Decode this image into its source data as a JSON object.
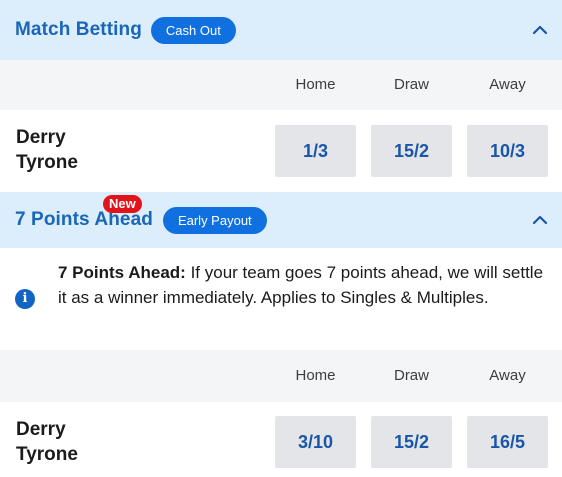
{
  "match_betting": {
    "title": "Match Betting",
    "badge": "Cash Out",
    "columns": [
      "Home",
      "Draw",
      "Away"
    ],
    "teams": [
      "Derry",
      "Tyrone"
    ],
    "odds": [
      "1/3",
      "15/2",
      "10/3"
    ]
  },
  "points_ahead": {
    "title": "7 Points Ahead",
    "new_badge": "New",
    "badge": "Early Payout",
    "info_title": "7 Points Ahead:",
    "info_body": " If your team goes 7 points ahead, we will settle it as a winner immediately. Applies to Singles & Multiples.",
    "columns": [
      "Home",
      "Draw",
      "Away"
    ],
    "teams": [
      "Derry",
      "Tyrone"
    ],
    "odds": [
      "3/10",
      "15/2",
      "16/5"
    ]
  },
  "icons": {
    "collapse": "chevron-up-icon",
    "info": "info-icon"
  },
  "colors": {
    "header_bg": "#dcedfb",
    "accent": "#1170e0",
    "odds_text": "#1a56a8",
    "new_badge": "#e3131a"
  }
}
